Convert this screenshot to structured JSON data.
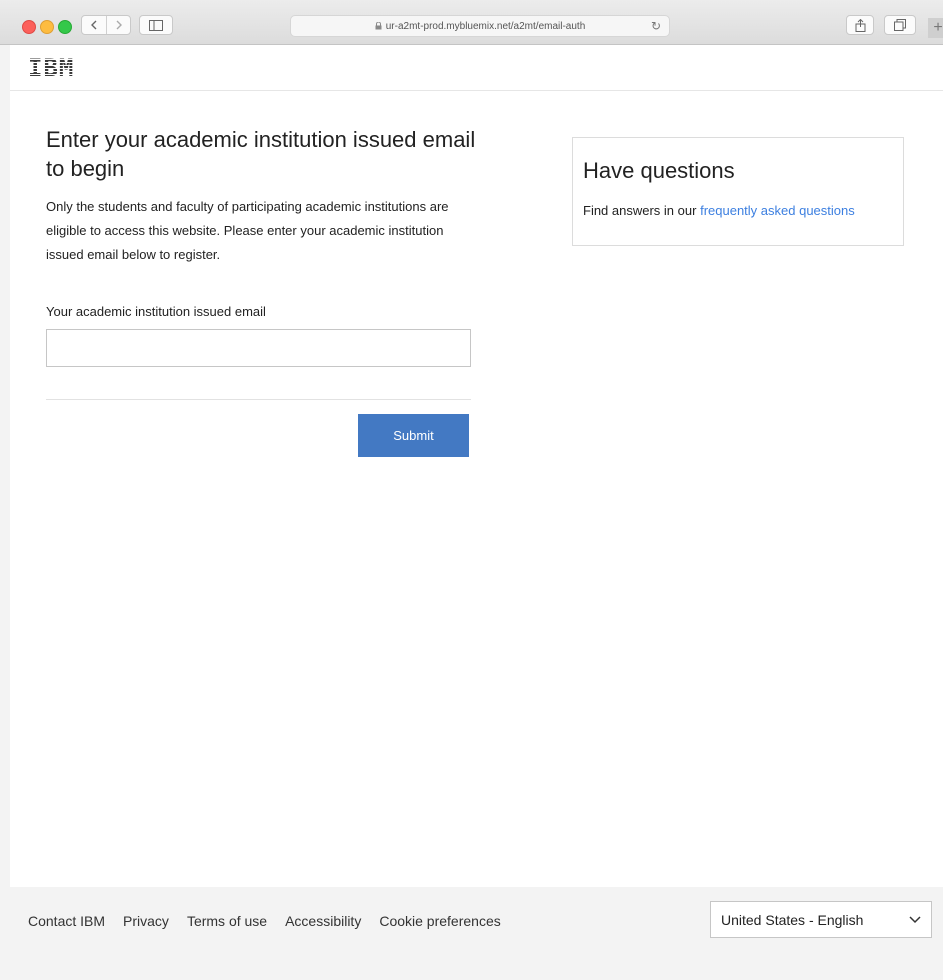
{
  "browser": {
    "url": "ur-a2mt-prod.mybluemix.net/a2mt/email-auth"
  },
  "masthead": {
    "logo": "IBM"
  },
  "form": {
    "heading": "Enter your academic institution issued email to begin",
    "description": "Only the students and faculty of participating academic institutions are eligible to access this website. Please enter your academic institution issued email below to register.",
    "field_label": "Your academic institution issued email",
    "email_value": "",
    "submit_label": "Submit"
  },
  "questions": {
    "title": "Have questions",
    "text_prefix": "Find answers in our",
    "link_label": "frequently asked questions"
  },
  "footer": {
    "links": [
      "Contact IBM",
      "Privacy",
      "Terms of use",
      "Accessibility",
      "Cookie preferences"
    ],
    "locale": "United States - English"
  },
  "colors": {
    "accent": "#4379c3",
    "link": "#3c7fe0",
    "footer_bg": "#f3f3f3"
  },
  "icons": [
    "back-icon",
    "forward-icon",
    "sidebar-icon",
    "lock-icon",
    "reload-icon",
    "share-icon",
    "tabs-icon",
    "plus-icon",
    "chevron-down-icon"
  ]
}
